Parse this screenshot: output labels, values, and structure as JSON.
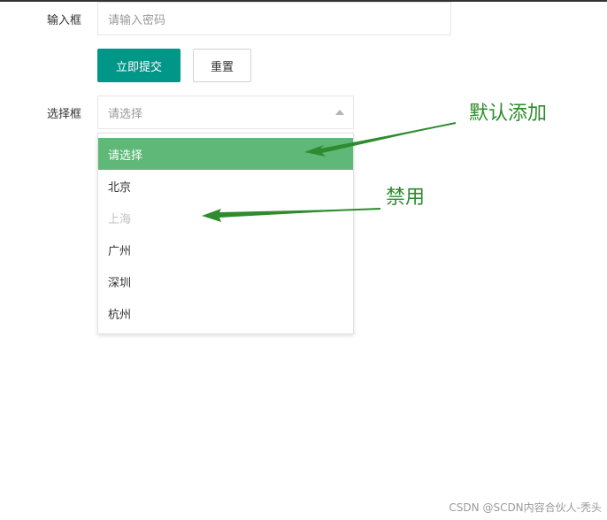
{
  "form": {
    "input_label": "输入框",
    "password_placeholder": "请输入密码",
    "submit_label": "立即提交",
    "reset_label": "重置",
    "select_label": "选择框",
    "select_placeholder": "请选择"
  },
  "dropdown": {
    "options": [
      {
        "label": "请选择",
        "state": "selected"
      },
      {
        "label": "北京",
        "state": "normal"
      },
      {
        "label": "上海",
        "state": "disabled"
      },
      {
        "label": "广州",
        "state": "normal"
      },
      {
        "label": "深圳",
        "state": "normal"
      },
      {
        "label": "杭州",
        "state": "normal"
      }
    ]
  },
  "annotations": {
    "default_added": "默认添加",
    "disabled": "禁用"
  },
  "watermark": "CSDN @SCDN内容合伙人-秃头",
  "colors": {
    "primary": "#009688",
    "selected_option": "#5fb878",
    "annotation": "#2e8b2e"
  }
}
